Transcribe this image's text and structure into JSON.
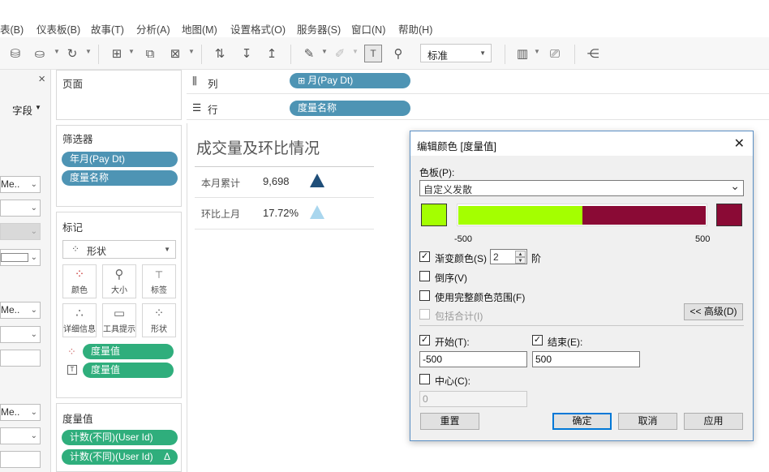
{
  "menu": [
    "表(B)",
    "仪表板(B)",
    "故事(T)",
    "分析(A)",
    "地图(M)",
    "设置格式(O)",
    "服务器(S)",
    "窗口(N)",
    "帮助(H)"
  ],
  "toolbar": {
    "mark_size_select": "标准"
  },
  "data_pane": {
    "close_glyph": "×",
    "fields_menu": "字段",
    "field_me": "Me.."
  },
  "shelves": {
    "pages": "页面",
    "columns_label": "列",
    "rows_label": "行",
    "columns_pill": "月(Pay Dt)",
    "rows_pill": "度量名称"
  },
  "filters": {
    "title": "筛选器",
    "items": [
      "年月(Pay Dt)",
      "度量名称"
    ]
  },
  "marks": {
    "title": "标记",
    "type": "形状",
    "buttons": [
      "颜色",
      "大小",
      "标签",
      "详细信息",
      "工具提示",
      "形状"
    ],
    "pills": [
      "度量值",
      "度量值"
    ]
  },
  "measure_values": {
    "title": "度量值",
    "items": [
      "计数(不同)(User Id)",
      "计数(不同)(User Id)"
    ],
    "delta_glyph": "Δ"
  },
  "worksheet": {
    "title": "成交量及环比情况",
    "rows": [
      {
        "label": "本月累计",
        "value": "9,698"
      },
      {
        "label": "环比上月",
        "value": "17.72%"
      }
    ]
  },
  "dialog": {
    "title": "编辑颜色 [度量值]",
    "palette_label": "色板(P):",
    "palette_value": "自定义发散",
    "range_min": "-500",
    "range_max": "500",
    "stepped_label": "渐变颜色(S)",
    "steps_value": "2",
    "steps_unit": "阶",
    "reversed_label": "倒序(V)",
    "full_range_label": "使用完整颜色范围(F)",
    "include_totals_label": "包括合计(I)",
    "advanced_button": "<< 高级(D)",
    "start_label": "开始(T):",
    "start_value": "-500",
    "end_label": "结束(E):",
    "end_value": "500",
    "center_label": "中心(C):",
    "center_value": "0",
    "reset_button": "重置",
    "ok_button": "确定",
    "cancel_button": "取消",
    "apply_button": "应用",
    "colors": {
      "start": "#a4ff00",
      "end": "#8a0a35",
      "arrow_up_dark": "#1f4e79",
      "arrow_up_light": "#a9d6ee"
    }
  }
}
